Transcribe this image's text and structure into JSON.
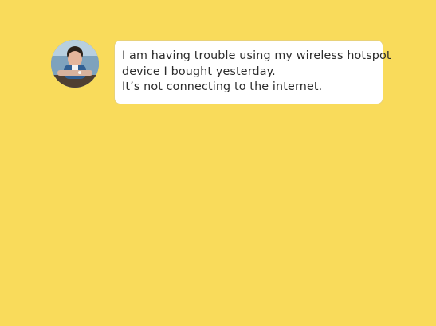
{
  "message": {
    "lines": [
      "I am having trouble using my wireless hotspot",
      "device I bought yesterday.",
      "It’s not connecting to the internet."
    ]
  },
  "avatar": {
    "icon": "person-photo-icon"
  }
}
